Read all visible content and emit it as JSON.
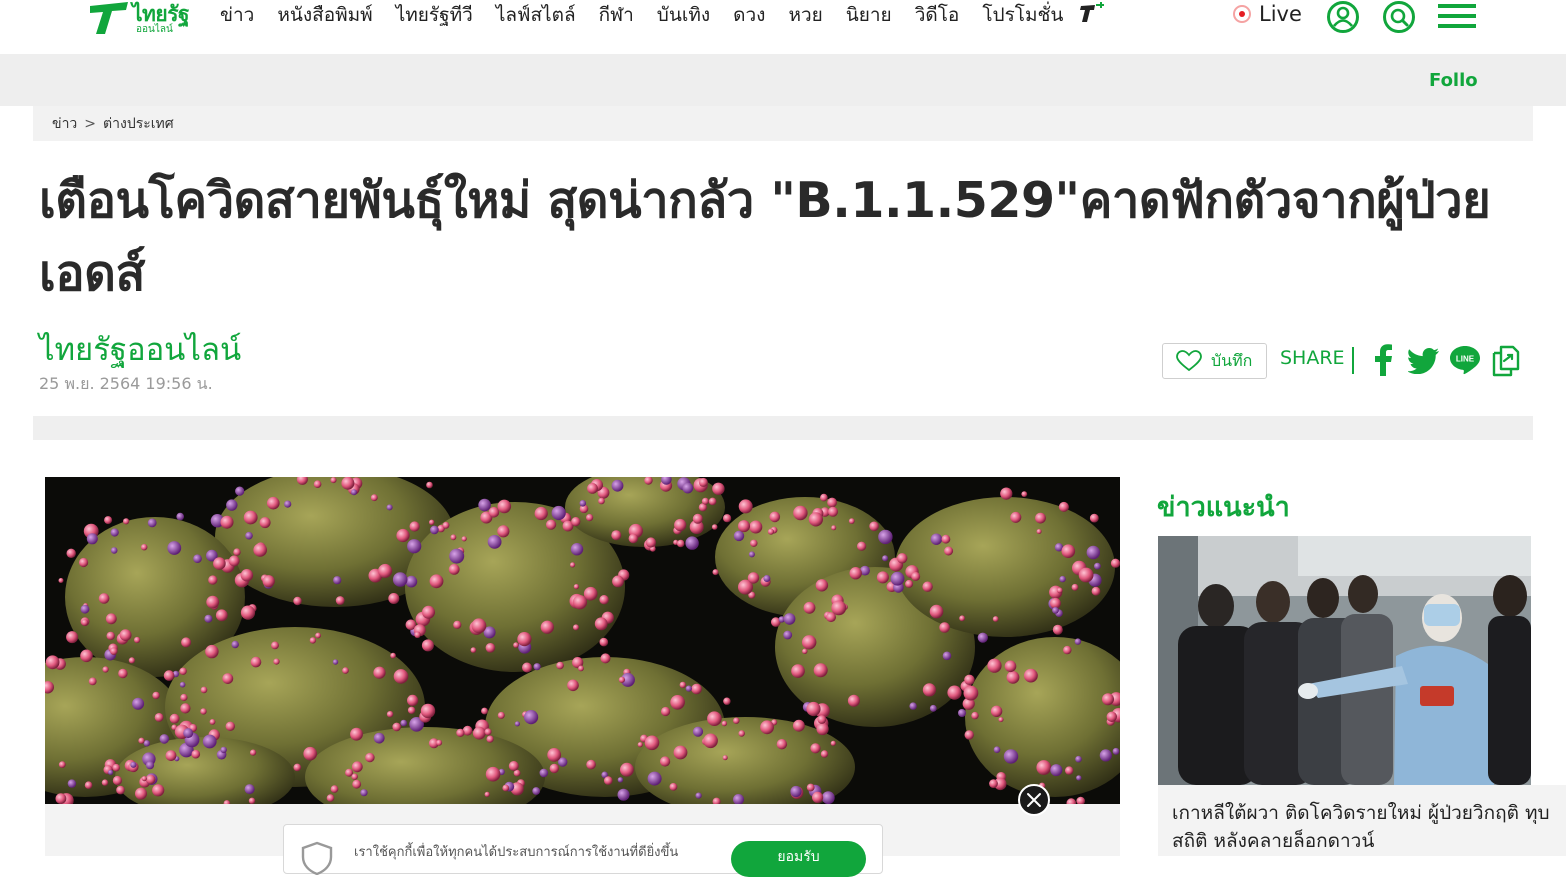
{
  "nav": {
    "logo_text": "ไทยรัฐ",
    "logo_sub": "ออนไลน์",
    "menu": [
      "ข่าว",
      "หนังสือพิมพ์",
      "ไทยรัฐทีวี",
      "ไลฟ์สไตล์",
      "กีฬา",
      "บันเทิง",
      "ดวง",
      "หวย",
      "นิยาย",
      "วิดีโอ",
      "โปรโมชั่น"
    ],
    "live_label": "Live"
  },
  "follow_text": "Follow",
  "breadcrumb": [
    "ข่าว",
    "ต่างประเทศ"
  ],
  "article": {
    "headline": "เตือนโควิดสายพันธุ์ใหม่ สุดน่ากลัว \"B.1.1.529\"คาดฟักตัวจากผู้ป่วยเอดส์",
    "source": "ไทยรัฐออนไลน์",
    "date": "25 พ.ย. 2564 19:56 น.",
    "save_label": "บันทึก",
    "share_label": "SHARE"
  },
  "cookie": {
    "text": "เราใช้คุกกี้เพื่อให้ทุกคนได้ประสบการณ์การใช้งานที่ดียิ่งขึ้น",
    "button": "ยอมรับ"
  },
  "sidebar": {
    "title": "ข่าวแนะนำ",
    "card_title_1": "เกาหลีใต้ผวา ติดโควิดรายใหม่ ผู้ป่วยวิกฤติ ทุบ",
    "card_title_2": "สถิติ หลังคลายล็อกดาวน์"
  },
  "colors": {
    "brand_green": "#11a63c",
    "live_red": "#e51c23"
  }
}
